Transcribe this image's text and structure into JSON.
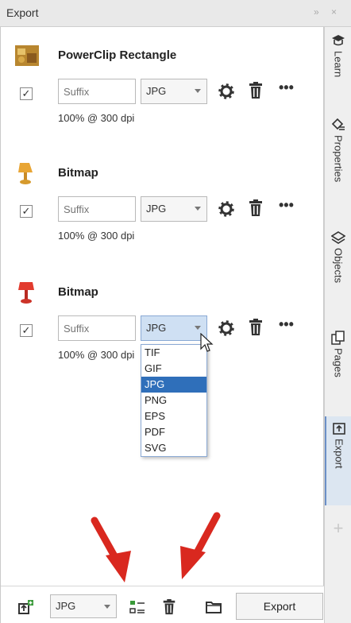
{
  "window": {
    "title": "Export",
    "controls": "» ×"
  },
  "sidebar": {
    "tabs": [
      {
        "label": "Learn",
        "icon": "graduation-icon"
      },
      {
        "label": "Properties",
        "icon": "properties-icon"
      },
      {
        "label": "Objects",
        "icon": "layers-icon"
      },
      {
        "label": "Pages",
        "icon": "pages-icon"
      },
      {
        "label": "Export",
        "icon": "export-icon",
        "active": true
      }
    ],
    "add_label": "+"
  },
  "items": [
    {
      "name": "PowerClip Rectangle",
      "checked": true,
      "suffix_placeholder": "Suffix",
      "format": "JPG",
      "resolution": "100% @ 300 dpi"
    },
    {
      "name": "Bitmap",
      "checked": true,
      "suffix_placeholder": "Suffix",
      "format": "JPG",
      "resolution": "100% @ 300 dpi"
    },
    {
      "name": "Bitmap",
      "checked": true,
      "suffix_placeholder": "Suffix",
      "format": "JPG",
      "resolution": "100% @ 300 dpi",
      "dropdown_open": true
    }
  ],
  "checkmark": "✓",
  "more_label": "•••",
  "dropdown": {
    "options": [
      "TIF",
      "GIF",
      "JPG",
      "PNG",
      "EPS",
      "PDF",
      "SVG"
    ],
    "selected": "JPG"
  },
  "bottom": {
    "format": "JPG",
    "export_label": "Export"
  },
  "colors": {
    "accent": "#2f6fba",
    "annotation_arrow": "#d9281f"
  }
}
